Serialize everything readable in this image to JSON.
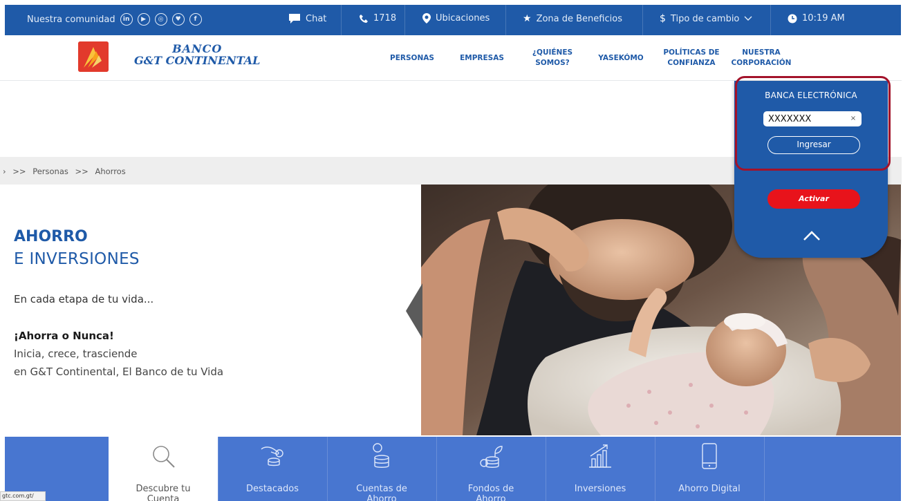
{
  "topbar": {
    "community_label": "Nuestra comunidad",
    "social": [
      "in",
      "▶",
      "◎",
      "♥",
      "f"
    ],
    "chat": "Chat",
    "phone": "1718",
    "locations": "Ubicaciones",
    "benefits": "Zona de Beneficios",
    "fx": "Tipo de cambio",
    "time": "10:19 AM"
  },
  "header": {
    "logo_line1": "BANCO",
    "logo_line2": "G&T CONTINENTAL",
    "nav": {
      "personas": "PERSONAS",
      "empresas": "EMPRESAS",
      "quienes_1": "¿QUIÉNES",
      "quienes_2": "SOMOS?",
      "yasekomo": "YASEKÓMO",
      "politicas_1": "POLÍTICAS DE",
      "politicas_2": "CONFIANZA",
      "nuestra_1": "NUESTRA",
      "nuestra_2": "CORPORACIÓN"
    }
  },
  "breadcrumb": {
    "lead": "›",
    "sep": ">>",
    "items": [
      "Personas",
      "Ahorros"
    ]
  },
  "hero": {
    "title": "AHORRO",
    "subtitle": "E INVERSIONES",
    "lead": "En cada etapa de tu vida...",
    "tagline": "¡Ahorra o Nunca!",
    "line1": "Inicia, crece, trasciende",
    "line2": "en G&T Continental, El Banco de tu Vida"
  },
  "ebank": {
    "title": "BANCA ELECTRÓNICA",
    "user_value": "XXXXXXX",
    "clear": "×",
    "login": "Ingresar",
    "activate": "Activar"
  },
  "bottom_nav": {
    "items": [
      {
        "label": "Descubre tu\nCuenta",
        "icon": "magnifier-icon"
      },
      {
        "label": "Destacados",
        "icon": "hand-coins-icon"
      },
      {
        "label": "Cuentas de\nAhorro",
        "icon": "coin-stack-icon"
      },
      {
        "label": "Fondos de\nAhorro",
        "icon": "plant-coins-icon"
      },
      {
        "label": "Inversiones",
        "icon": "growth-chart-icon"
      },
      {
        "label": "Ahorro Digital",
        "icon": "smartphone-icon"
      }
    ]
  },
  "status_url": "gtc.com.gt/",
  "colors": {
    "brand_blue": "#1f5aa8",
    "nav_blue": "#4876d0",
    "brand_red": "#e23a2c",
    "activate_red": "#e8131b",
    "highlight": "#a3122a"
  }
}
